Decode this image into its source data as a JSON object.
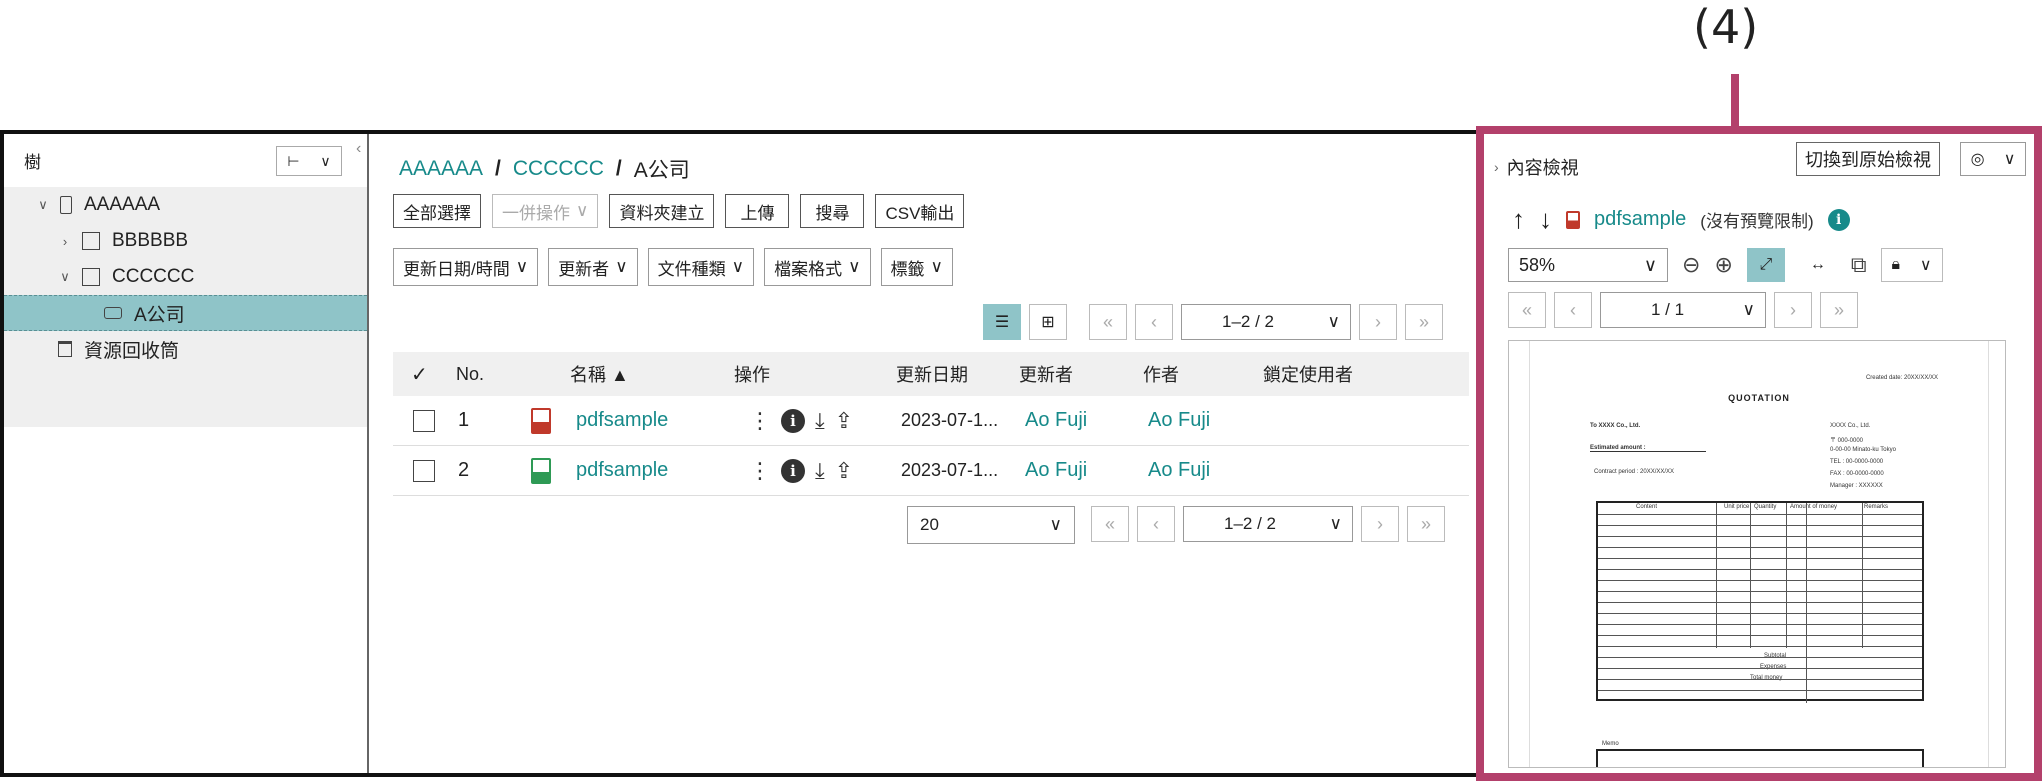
{
  "callout": "(4)",
  "tree": {
    "header": "樹",
    "toggle_icon": "tree-icon",
    "items": [
      {
        "label": "AAAAAA",
        "chevron": "∨"
      },
      {
        "label": "BBBBBB",
        "chevron": "›"
      },
      {
        "label": "CCCCCC",
        "chevron": "∨"
      },
      {
        "label": "A公司",
        "chevron": ""
      },
      {
        "label": "資源回收筒",
        "chevron": ""
      }
    ]
  },
  "breadcrumb": [
    "AAAAAA",
    "CCCCCC",
    "A公司"
  ],
  "toolbar": {
    "select_all": "全部選擇",
    "bulk": "一併操作",
    "create_folder": "資料夾建立",
    "upload": "上傳",
    "search": "搜尋",
    "csv": "CSV輸出"
  },
  "filters": [
    "更新日期/時間",
    "更新者",
    "文件種類",
    "檔案格式",
    "標籤"
  ],
  "pager": {
    "range": "1–2 / 2"
  },
  "table": {
    "headers": {
      "no": "No.",
      "name": "名稱 ▲",
      "ops": "操作",
      "updated": "更新日期",
      "updater": "更新者",
      "author": "作者",
      "locker": "鎖定使用者"
    },
    "rows": [
      {
        "no": "1",
        "name": "pdfsample",
        "type": "pdf",
        "updated": "2023-07-1...",
        "updater": "Ao Fuji",
        "author": "Ao Fuji"
      },
      {
        "no": "2",
        "name": "pdfsample",
        "type": "xls",
        "updated": "2023-07-1...",
        "updater": "Ao Fuji",
        "author": "Ao Fuji"
      }
    ]
  },
  "per_page": "20",
  "preview": {
    "header": "內容檢視",
    "switch": "切換到原始檢視",
    "title": "pdfsample",
    "note": "(沒有預覽限制)",
    "zoom": "58%",
    "page": "1 / 1"
  },
  "doc": {
    "created": "Created date: 20XX/XX/XX",
    "title": "QUOTATION",
    "to": "To XXXX Co., Ltd.",
    "estimated": "Estimated amount :",
    "period": "Contract period : 20XX/XX/XX",
    "from1": "XXXX Co., Ltd.",
    "from2": "〒 000-0000",
    "from3": "0-00-00 Minato-ku Tokyo",
    "from4": "TEL : 00-0000-0000",
    "from5": "FAX : 00-0000-0000",
    "from6": "Manager : XXXXXX",
    "cols": [
      "Content",
      "Unit price",
      "Quantity",
      "Amount of money",
      "Remarks"
    ],
    "subtotal": "Subtotal",
    "expenses": "Expenses",
    "total": "Total money",
    "memo": "Memo"
  }
}
